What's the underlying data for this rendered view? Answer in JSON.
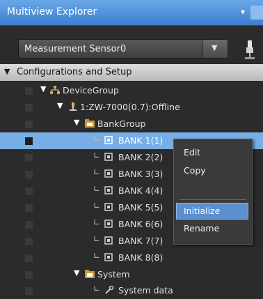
{
  "panel": {
    "title": "Multiview Explorer",
    "pin_glyph": "▾ ⊥"
  },
  "selector": {
    "value": "Measurement Sensor0",
    "arrow_glyph": "▼"
  },
  "section": {
    "label": "Configurations and Setup",
    "arrow": "▼"
  },
  "tree": {
    "device_group": "DeviceGroup",
    "device": "1:ZW-7000(0.7):Offline",
    "bank_group": "BankGroup",
    "banks": [
      "BANK 1(1)",
      "BANK 2(2)",
      "BANK 3(3)",
      "BANK 4(4)",
      "BANK 5(5)",
      "BANK 6(6)",
      "BANK 7(7)",
      "BANK 8(8)"
    ],
    "system": "System",
    "system_data": "System data",
    "expanded_glyph": "▼",
    "branch_glyph": "∟"
  },
  "context_menu": {
    "items": [
      "Edit",
      "Copy",
      "Initialize",
      "Rename"
    ],
    "highlighted": "Initialize"
  },
  "colors": {
    "titlebar": "#4a8ad8",
    "selection": "#78aee6",
    "menu_highlight": "#5b8fd0"
  }
}
